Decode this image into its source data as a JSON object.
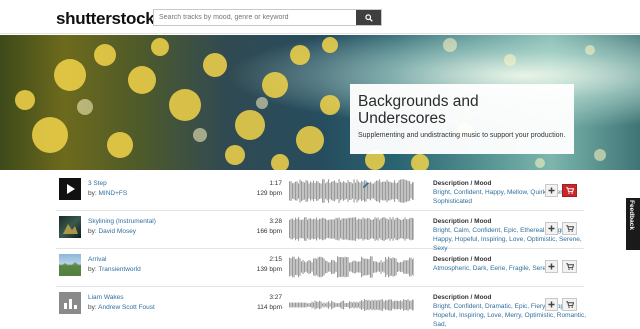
{
  "header": {
    "logo": "shutterstock",
    "search_placeholder": "Search tracks by mood, genre or keyword"
  },
  "hero": {
    "title": "Backgrounds and Underscores",
    "subtitle": "Supplementing and undistracting music to support your production."
  },
  "tracks": [
    {
      "title": "3 Step",
      "artist_prefix": "by:",
      "artist": "MIND+FS",
      "duration": "1:17",
      "bpm": "129 bpm",
      "desc_heading": "Description / Mood",
      "description": "Bright, Confident, Happy, Mellow, Quirky, Serene, Sophisticated",
      "thumb": "play-icon",
      "cart_active": true
    },
    {
      "title": "Skylining (Instrumental)",
      "artist_prefix": "by:",
      "artist": "David Mosey",
      "duration": "3:28",
      "bpm": "166 bpm",
      "desc_heading": "Description / Mood",
      "description": "Bright, Calm, Confident, Epic, Ethereal, Fragile, Happy, Hopeful, Inspiring, Love, Optimistic, Serene, Sexy",
      "thumb": "album-art",
      "cart_active": false
    },
    {
      "title": "Arrival",
      "artist_prefix": "by:",
      "artist": "Transientworld",
      "duration": "2:15",
      "bpm": "139 bpm",
      "desc_heading": "Description / Mood",
      "description": "Atmospheric, Dark, Eerie, Fragile, Serene",
      "thumb": "landscape-art",
      "cart_active": false
    },
    {
      "title": "Liam Wakes",
      "artist_prefix": "by:",
      "artist": "Andrew Scott Foust",
      "duration": "3:27",
      "bpm": "114 bpm",
      "desc_heading": "Description / Mood",
      "description": "Bright, Confident, Dramatic, Epic, Fiery, Happy, Hopeful, Inspiring, Love, Merry, Optimistic, Romantic, Sad,",
      "thumb": "chart-art",
      "cart_active": false
    }
  ],
  "feedback_label": "Feedback",
  "colors": {
    "accent_link": "#2f6f9e",
    "cart_active": "#c9282a"
  }
}
